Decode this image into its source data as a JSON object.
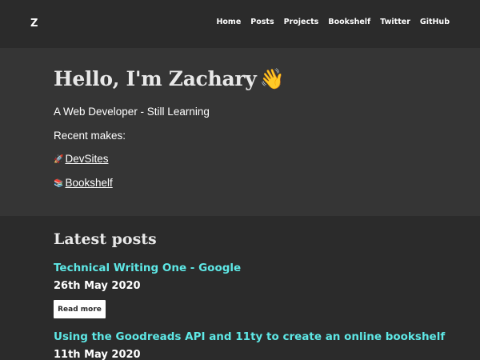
{
  "header": {
    "logo": "Z",
    "nav": [
      "Home",
      "Posts",
      "Projects",
      "Bookshelf",
      "Twitter",
      "GitHub"
    ]
  },
  "hero": {
    "title": "Hello, I'm Zachary",
    "wave_emoji": "👋",
    "subtitle": "A Web Developer - Still Learning",
    "recent_label": "Recent makes:",
    "makes": [
      {
        "emoji": "🚀",
        "label": "DevSites"
      },
      {
        "emoji": "📚",
        "label": "Bookshelf"
      }
    ]
  },
  "latest": {
    "title": "Latest posts",
    "posts": [
      {
        "title": "Technical Writing One - Google",
        "date": "26th May 2020",
        "button": "Read more"
      },
      {
        "title": "Using the Goodreads API and 11ty to create an online bookshelf",
        "date": "11th May 2020"
      }
    ]
  },
  "colors": {
    "page_background": "#2b2b2b",
    "hero_background": "#353535",
    "post_link": "#5ee8e6",
    "text": "#ffffff"
  }
}
